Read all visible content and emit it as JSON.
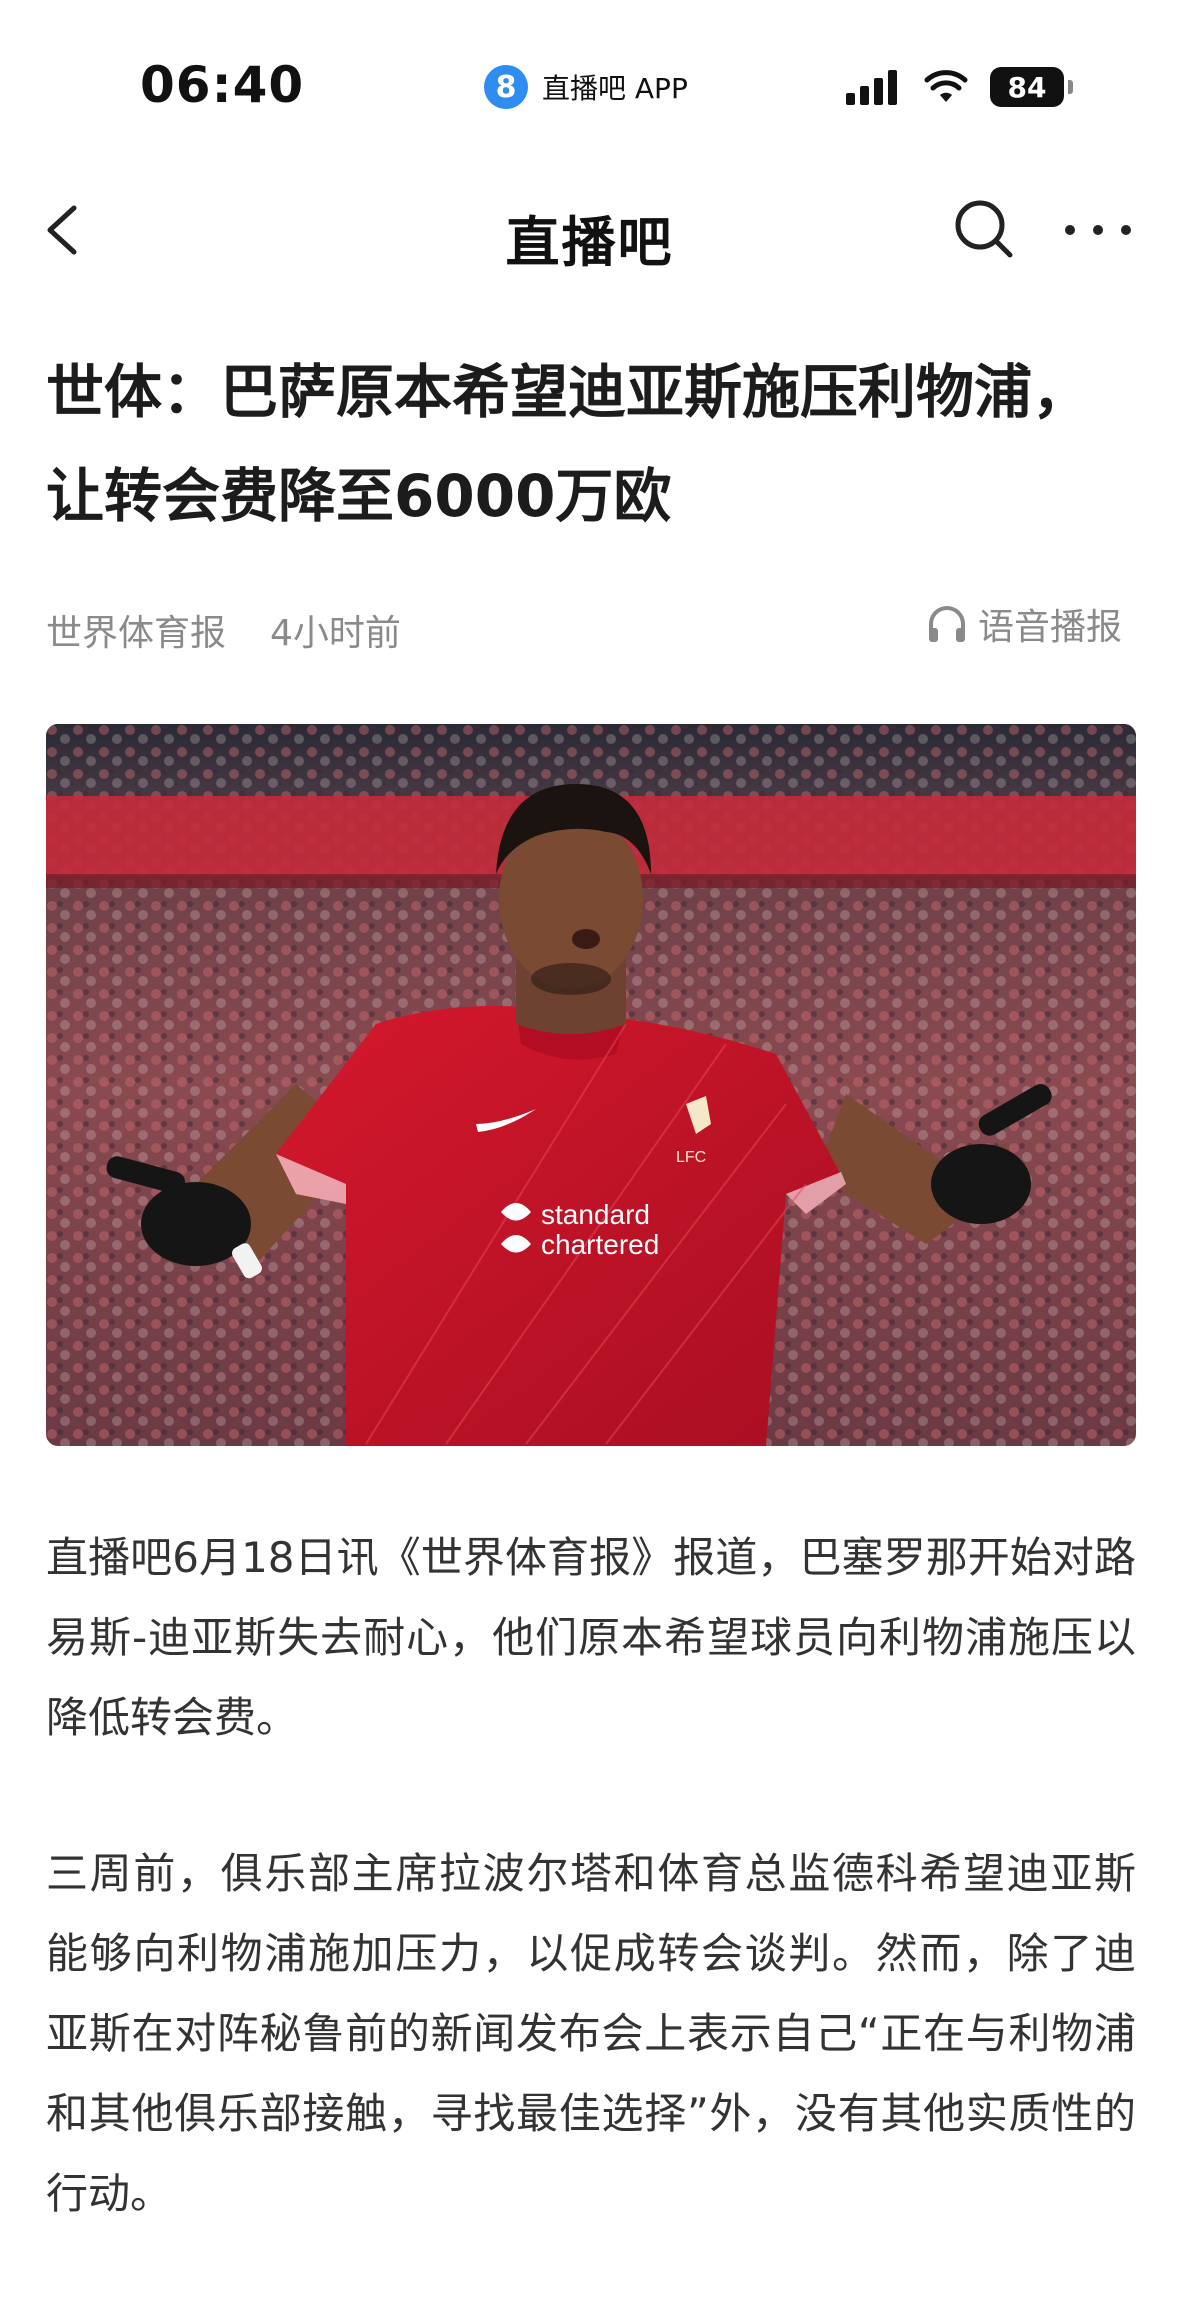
{
  "status_bar": {
    "time": "06:40",
    "app_badge": "8",
    "app_label": "直播吧 APP",
    "battery": "84"
  },
  "nav": {
    "title": "直播吧"
  },
  "article": {
    "title": "世体：巴萨原本希望迪亚斯施压利物浦，让转会费降至6000万欧",
    "source": "世界体育报",
    "time": "4小时前",
    "audio_label": "语音播报",
    "image": {
      "jersey_sponsor_line1": "standard",
      "jersey_sponsor_line2": "chartered",
      "crest_label": "LFC"
    },
    "paragraphs": [
      "直播吧6月18日讯《世界体育报》报道，巴塞罗那开始对路易斯-迪亚斯失去耐心，他们原本希望球员向利物浦施压以降低转会费。",
      "三周前，俱乐部主席拉波尔塔和体育总监德科希望迪亚斯能够向利物浦施加压力，以促成转会谈判。然而，除了迪亚斯在对阵秘鲁前的新闻发布会上表示自己“正在与利物浦和其他俱乐部接触，寻找最佳选择”外，没有其他实质性的行动。"
    ]
  },
  "colors": {
    "accent_blue": "#2f8cf0",
    "jersey_red": "#c8102e",
    "meta_gray": "#8a8a8a"
  }
}
